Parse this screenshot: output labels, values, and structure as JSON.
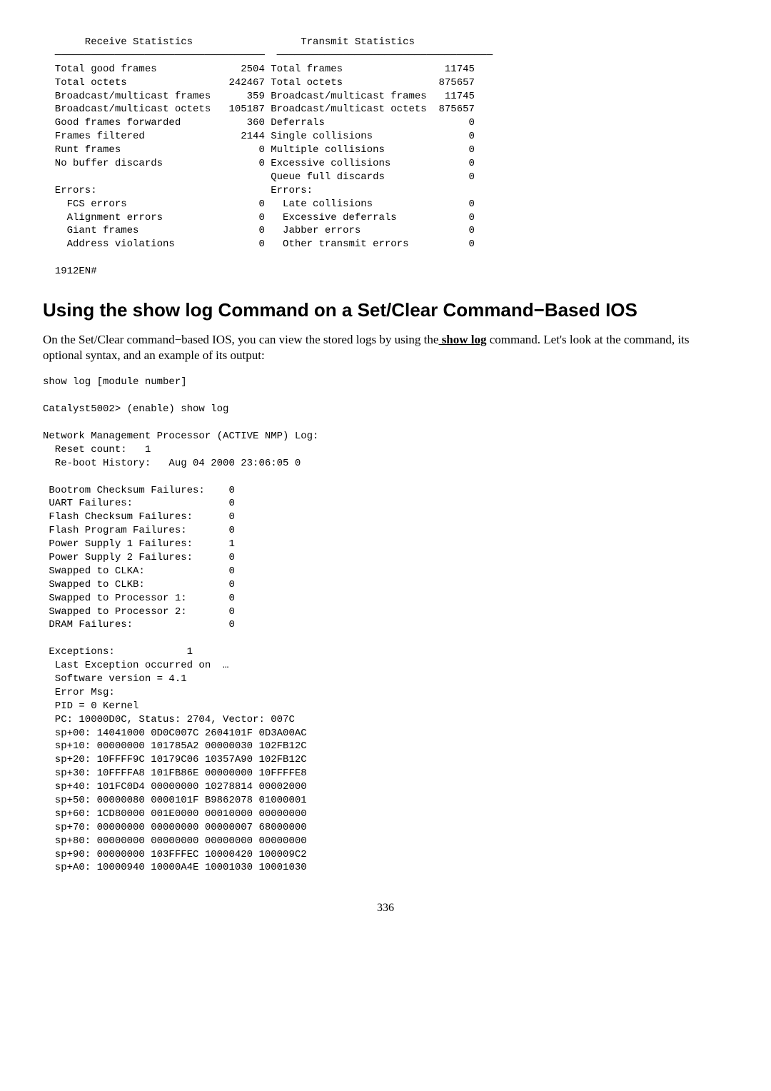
{
  "stats_block": "       Receive Statistics                  Transmit Statistics\n  ───────────────────────────────────  ────────────────────────────────────\n  Total good frames              2504 Total frames                 11745\n  Total octets                 242467 Total octets                875657\n  Broadcast/multicast frames      359 Broadcast/multicast frames   11745\n  Broadcast/multicast octets   105187 Broadcast/multicast octets  875657\n  Good frames forwarded           360 Deferrals                        0\n  Frames filtered                2144 Single collisions                0\n  Runt frames                       0 Multiple collisions              0\n  No buffer discards                0 Excessive collisions             0\n                                      Queue full discards              0\n  Errors:                             Errors:\n    FCS errors                      0   Late collisions                0\n    Alignment errors                0   Excessive deferrals            0\n    Giant frames                    0   Jabber errors                  0\n    Address violations              0   Other transmit errors          0\n\n  1912EN#",
  "heading": "Using the show log Command on a Set/Clear Command−Based IOS",
  "paragraph_pre": "On the Set/Clear command−based IOS, you can view the stored logs by using the",
  "paragraph_cmd": " show log",
  "paragraph_post": " command. Let's look at the command, its optional syntax, and an example of its output:",
  "log_block": "show log [module number]\n\nCatalyst5002> (enable) show log\n\nNetwork Management Processor (ACTIVE NMP) Log:\n  Reset count:   1\n  Re-boot History:   Aug 04 2000 23:06:05 0\n\n Bootrom Checksum Failures:    0\n UART Failures:                0\n Flash Checksum Failures:      0\n Flash Program Failures:       0\n Power Supply 1 Failures:      1\n Power Supply 2 Failures:      0\n Swapped to CLKA:              0\n Swapped to CLKB:              0\n Swapped to Processor 1:       0\n Swapped to Processor 2:       0\n DRAM Failures:                0\n\n Exceptions:            1\n  Last Exception occurred on  …\n  Software version = 4.1\n  Error Msg:\n  PID = 0 Kernel\n  PC: 10000D0C, Status: 2704, Vector: 007C\n  sp+00: 14041000 0D0C007C 2604101F 0D3A00AC\n  sp+10: 00000000 101785A2 00000030 102FB12C\n  sp+20: 10FFFF9C 10179C06 10357A90 102FB12C\n  sp+30: 10FFFFA8 101FB86E 00000000 10FFFFE8\n  sp+40: 101FC0D4 00000000 10278814 00002000\n  sp+50: 00000080 0000101F B9862078 01000001\n  sp+60: 1CD80000 001E0000 00010000 00000000\n  sp+70: 00000000 00000000 00000007 68000000\n  sp+80: 00000000 00000000 00000000 00000000\n  sp+90: 00000000 103FFFEC 10000420 100009C2\n  sp+A0: 10000940 10000A4E 10001030 10001030",
  "page_number": "336"
}
